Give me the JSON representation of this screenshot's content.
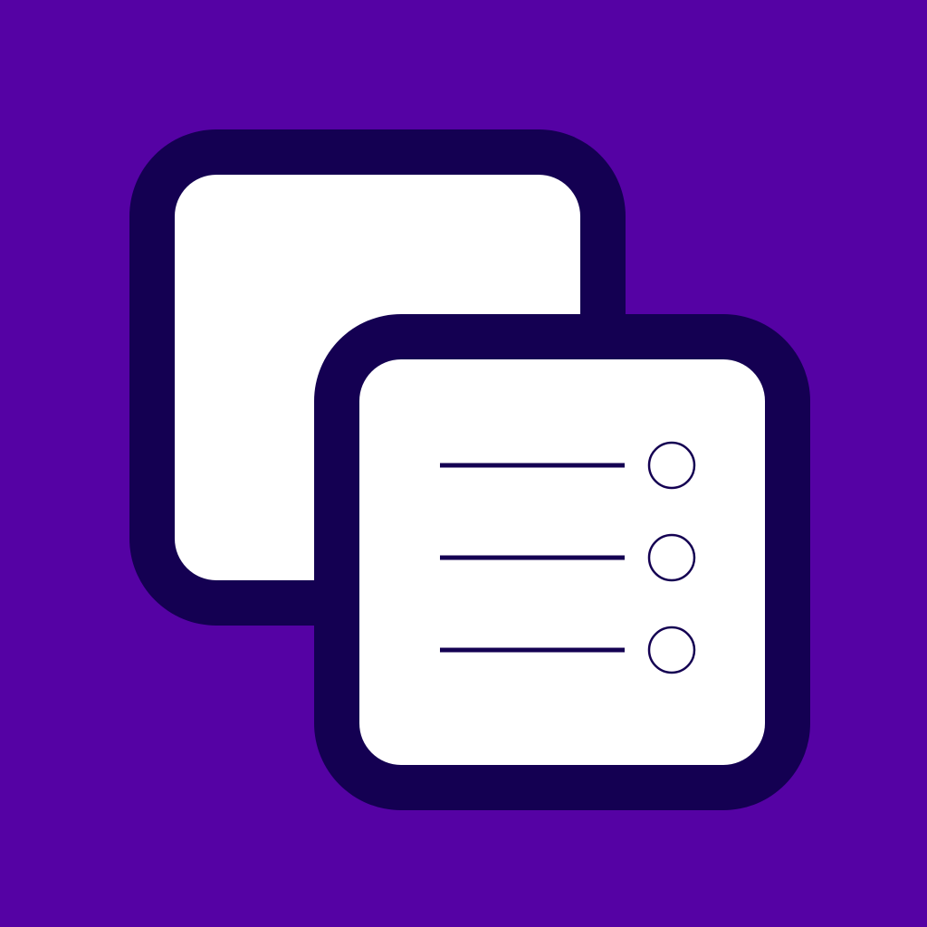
{
  "icon": {
    "name": "overlapping-windows-list-icon",
    "colors": {
      "background": "#5502a4",
      "outline": "#140052",
      "fill": "#ffffff",
      "stroke": "#140052"
    },
    "list_rows": 3
  }
}
